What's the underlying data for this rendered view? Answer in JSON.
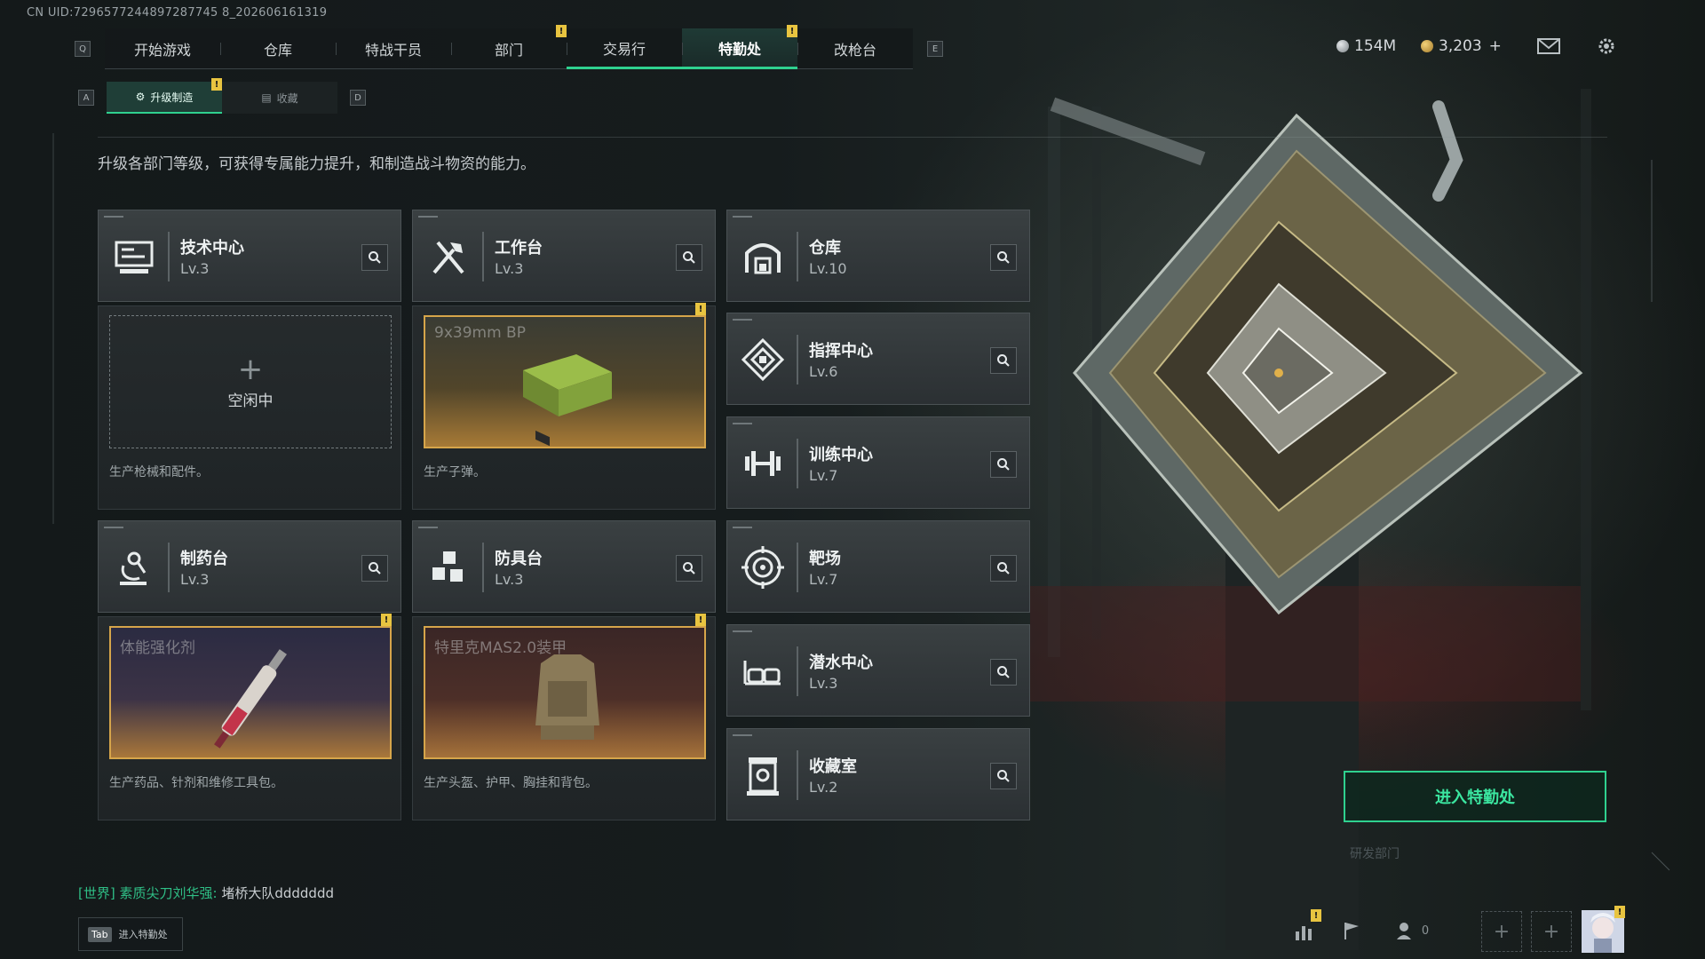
{
  "uid": "CN UID:7296577244897287745 8_202606161319",
  "nav": {
    "left_key": "Q",
    "right_key": "E",
    "tabs": [
      {
        "label": "开始游戏"
      },
      {
        "label": "仓库"
      },
      {
        "label": "特战干员"
      },
      {
        "label": "部门"
      },
      {
        "label": "交易行"
      },
      {
        "label": "特勤处"
      },
      {
        "label": "改枪台"
      }
    ],
    "badge": "!"
  },
  "currency": {
    "silver": "154M",
    "gold": "3,203",
    "add": "+"
  },
  "subnav": {
    "left_key": "A",
    "right_key": "D",
    "tabs": [
      {
        "label": "升级制造"
      },
      {
        "label": "收藏"
      }
    ]
  },
  "description": "升级各部门等级，可获得专属能力提升，和制造战斗物资的能力。",
  "departments": {
    "tech": {
      "name": "技术中心",
      "level": "Lv.3",
      "icon": "monitor-icon"
    },
    "workbench": {
      "name": "工作台",
      "level": "Lv.3",
      "icon": "tools-icon"
    },
    "pharmacy": {
      "name": "制药台",
      "level": "Lv.3",
      "icon": "microscope-icon"
    },
    "armor": {
      "name": "防具台",
      "level": "Lv.3",
      "icon": "cubes-icon"
    },
    "warehouse": {
      "name": "仓库",
      "level": "Lv.10",
      "icon": "warehouse-icon"
    },
    "command": {
      "name": "指挥中心",
      "level": "Lv.6",
      "icon": "command-icon"
    },
    "training": {
      "name": "训练中心",
      "level": "Lv.7",
      "icon": "dumbbell-icon"
    },
    "range": {
      "name": "靶场",
      "level": "Lv.7",
      "icon": "target-icon"
    },
    "diving": {
      "name": "潜水中心",
      "level": "Lv.3",
      "icon": "goggles-icon"
    },
    "collection": {
      "name": "收藏室",
      "level": "Lv.2",
      "icon": "display-case-icon"
    }
  },
  "production": {
    "tech": {
      "idle_label": "空闲中",
      "desc": "生产枪械和配件。"
    },
    "workbench": {
      "item": "9x39mm BP",
      "desc": "生产子弹。"
    },
    "pharmacy": {
      "item": "体能强化剂",
      "desc": "生产药品、针剂和维修工具包。"
    },
    "armor": {
      "item": "特里克MAS2.0装甲",
      "desc": "生产头盔、护甲、胸挂和背包。"
    }
  },
  "enter_button": "进入特勤处",
  "chat": {
    "channel": "[世界]",
    "sender": "素质尖刀刘华强:",
    "message": "堵桥大队ddddddd"
  },
  "tab_hint": {
    "key": "Tab",
    "label": "进入特勤处"
  },
  "friends_count": "0",
  "colors": {
    "accent": "#2fd18f",
    "badge": "#e8c440",
    "item_border": "#d6a54a"
  }
}
